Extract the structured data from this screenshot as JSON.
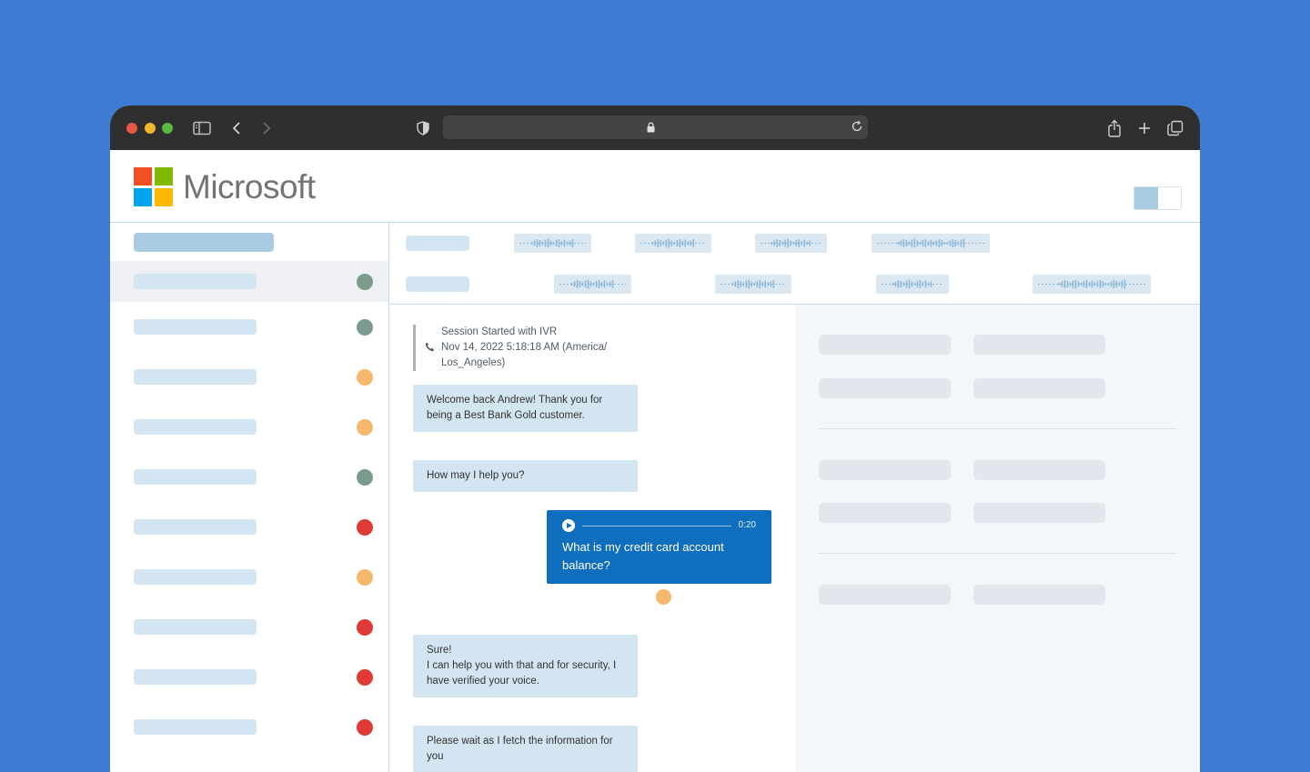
{
  "brand": {
    "name": "Microsoft",
    "logo_colors": [
      "#f25022",
      "#7fba00",
      "#00a4ef",
      "#ffb900"
    ]
  },
  "browser": {
    "icons": [
      "sidebar-icon",
      "back-icon",
      "forward-icon",
      "shield-icon",
      "lock-icon",
      "reload-icon",
      "share-icon",
      "new-tab-icon",
      "tabs-overview-icon"
    ]
  },
  "status_colors": {
    "green": "#7b9b8d",
    "orange": "#f5b86c",
    "red": "#de3b36"
  },
  "sidebar": {
    "items": [
      {
        "status": "green",
        "active": true
      },
      {
        "status": "green",
        "active": false
      },
      {
        "status": "orange",
        "active": false
      },
      {
        "status": "orange",
        "active": false
      },
      {
        "status": "green",
        "active": false
      },
      {
        "status": "red",
        "active": false
      },
      {
        "status": "orange",
        "active": false
      },
      {
        "status": "red",
        "active": false
      },
      {
        "status": "red",
        "active": false
      },
      {
        "status": "red",
        "active": false
      }
    ]
  },
  "chat": {
    "session": {
      "title": "Session Started with IVR",
      "timestamp": "Nov 14, 2022 5:18:18 AM (America/",
      "timezone": "Los_Angeles)"
    },
    "messages": [
      {
        "text": "Welcome back Andrew! Thank you for being a Best Bank Gold customer.",
        "direction": "incoming"
      },
      {
        "text": "How may I help you?",
        "direction": "incoming"
      },
      {
        "text": "What is my credit card account balance?",
        "direction": "outgoing",
        "audio_duration": "0:20"
      },
      {
        "text_lines": [
          "Sure!",
          "I can help you with that and for security, I have verified your voice."
        ],
        "direction": "incoming"
      },
      {
        "text": "Please wait as I fetch the information for you",
        "direction": "incoming"
      }
    ]
  }
}
